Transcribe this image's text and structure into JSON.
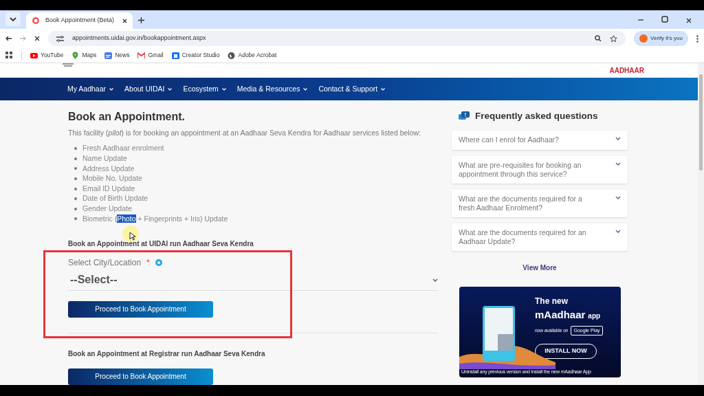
{
  "browser": {
    "tab_title": "Book Appointment (Beta)",
    "url": "appointments.uidai.gov.in/bookappointment.aspx",
    "profile_button": "Verify it's you",
    "bookmarks": [
      {
        "label": "YouTube",
        "kind": "video"
      },
      {
        "label": "Maps",
        "kind": "pin"
      },
      {
        "label": "News",
        "kind": "news"
      },
      {
        "label": "Gmail",
        "kind": "mail"
      },
      {
        "label": "Creator Studio",
        "kind": "studio"
      },
      {
        "label": "Adobe Acrobat",
        "kind": "globe"
      }
    ]
  },
  "site": {
    "brand": "AADHAAR",
    "nav": [
      {
        "label": "My Aadhaar"
      },
      {
        "label": "About UIDAI"
      },
      {
        "label": "Ecosystem"
      },
      {
        "label": "Media & Resources"
      },
      {
        "label": "Contact & Support"
      }
    ]
  },
  "main": {
    "heading": "Book an Appointment.",
    "description": "This facility (*pilot*) is for booking an appointment at an Aadhaar Seva Kendra for Aadhaar services listed below:",
    "services": [
      {
        "text": "Fresh Aadhaar enrolment"
      },
      {
        "text": "Name Update"
      },
      {
        "text": "Address Update"
      },
      {
        "text": "Mobile No. Update"
      },
      {
        "text": "Email ID Update"
      },
      {
        "text": "Date of Birth Update"
      },
      {
        "text": "Gender Update"
      },
      {
        "text": "Biometric (",
        "selected_text": "Photo",
        "text_after": " + Fingerprints + Iris) Update"
      }
    ],
    "uidai_section": {
      "heading": "Book an Appointment at UIDAI run Aadhaar Seva Kendra",
      "field_label": "Select City/Location",
      "required_mark": "*",
      "select_value": "--Select--",
      "button": "Proceed to Book Appointment"
    },
    "registrar_section": {
      "heading": "Book an Appointment at Registrar run Aadhaar Seva Kendra",
      "button": "Proceed to Book Appointment"
    }
  },
  "faq": {
    "title": "Frequently asked questions",
    "items": [
      {
        "question": "Where can I enrol for Aadhaar?",
        "expanded": false
      },
      {
        "question": "What are pre-requisites for booking an appointment through this service?",
        "expanded": false
      },
      {
        "question": "What are the documents required for a fresh Aadhaar Enrolment?",
        "expanded": false
      },
      {
        "question": "What are the documents required for an Aadhaar Update?",
        "expanded": false
      }
    ],
    "view_more": "View More"
  },
  "promo": {
    "line1": "The new",
    "app_name": "mAadhaar",
    "app_word": "app",
    "available": "now available on",
    "store_badge": "Google Play",
    "install": "INSTALL NOW",
    "footnote": "Uninstall any previous version and install the new mAadhaar App"
  }
}
